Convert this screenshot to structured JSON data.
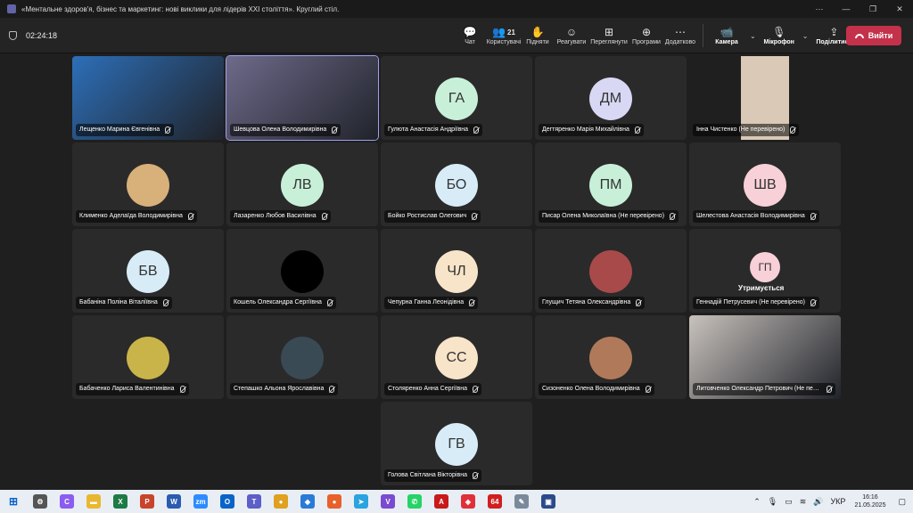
{
  "window": {
    "title": "«Ментальне здоров'я, бізнес та маркетинг: нові виклики для лідерів XXI століття». Круглий стіл.",
    "controls": [
      "⋯",
      "—",
      "❐",
      "✕"
    ]
  },
  "toolbar": {
    "timer": "02:24:18",
    "tools": [
      {
        "name": "chat",
        "icon": "💬",
        "label": "Чат"
      },
      {
        "name": "people",
        "icon": "👥",
        "count": "21",
        "label": "Користувачі"
      },
      {
        "name": "raise",
        "icon": "✋",
        "label": "Підняти"
      },
      {
        "name": "react",
        "icon": "☺",
        "label": "Реагувати"
      },
      {
        "name": "view",
        "icon": "⊞",
        "label": "Переглянути"
      },
      {
        "name": "apps",
        "icon": "⊕",
        "label": "Програми"
      },
      {
        "name": "more",
        "icon": "⋯",
        "label": "Додатково"
      }
    ],
    "camera": {
      "icon": "📹",
      "label": "Камера"
    },
    "mic": {
      "icon": "🎙",
      "label": "Мікрофон"
    },
    "share": {
      "icon": "⇪",
      "label": "Поділитися"
    },
    "leave": "Вийти"
  },
  "participants": [
    {
      "name": "Лещенко Марина Євгенівна",
      "kind": "video",
      "bg": "#2d6fb8"
    },
    {
      "name": "Шевцова Олена Володимирівна",
      "kind": "video",
      "bg": "#6e6a8a",
      "selected": true
    },
    {
      "name": "Гулюта Анастасія Андріївна",
      "initials": "ГА",
      "color": "#c8f0d8"
    },
    {
      "name": "Дегтяренко Марія Михайлівна",
      "initials": "ДМ",
      "color": "#d8d8f4"
    },
    {
      "name": "Інна Чистенко (Не перевірено)",
      "kind": "video",
      "bg": "#d9c9b6"
    },
    {
      "name": "Клименко Аделаїда Володимирівна",
      "kind": "photo",
      "bg": "#d8b07a"
    },
    {
      "name": "Лазаренко Любов Василівна",
      "initials": "ЛВ",
      "color": "#c8f0d8"
    },
    {
      "name": "Бойко Ростислав Олегович",
      "initials": "БО",
      "color": "#d8ecf8"
    },
    {
      "name": "Писар Олена Миколаївна (Не перевірено)",
      "initials": "ПМ",
      "color": "#c8f0d8"
    },
    {
      "name": "Шелестова Анастасія Володимирівна",
      "initials": "ШВ",
      "color": "#f8d0d8"
    },
    {
      "name": "Бабаніна Поліна Віталіївна",
      "initials": "БВ",
      "color": "#d8ecf8"
    },
    {
      "name": "Кошель Олександра Сергіївна",
      "kind": "photo",
      "bg": "#000000"
    },
    {
      "name": "Чепурна Ганна Леонідівна",
      "initials": "ЧЛ",
      "color": "#f8e4c8"
    },
    {
      "name": "Глущич Тетяна Олександрівна",
      "kind": "photo",
      "bg": "#a84a4a"
    },
    {
      "name": "Геннадій Петрусевич (Не перевірено)",
      "initials": "ГП",
      "color": "#f8d0d8",
      "small": true,
      "status": "Утримується"
    },
    {
      "name": "Бабаченко Лариса Валентинівна",
      "kind": "photo",
      "bg": "#c9b44a"
    },
    {
      "name": "Степашко Альона Ярославівна",
      "kind": "photo",
      "bg": "#3a4a55"
    },
    {
      "name": "Столяренко Анна Сергіївна",
      "initials": "СС",
      "color": "#f8e4c8"
    },
    {
      "name": "Сизоненко Олена Володимирівна",
      "kind": "photo",
      "bg": "#b07a5a"
    },
    {
      "name": "Литовченко Олександр Петрович (Не перевірено)",
      "kind": "video",
      "bg": "#c8c2bc"
    },
    {
      "name": "Голова Світлана Вікторівна",
      "initials": "ГВ",
      "color": "#d8ecf8"
    }
  ],
  "taskbar": {
    "apps": [
      {
        "name": "settings",
        "label": "⚙",
        "color": "#555"
      },
      {
        "name": "copilot",
        "label": "C",
        "color": "#8a5cf0"
      },
      {
        "name": "explorer",
        "label": "▬",
        "color": "#e8b830"
      },
      {
        "name": "excel",
        "label": "X",
        "color": "#1d7a45"
      },
      {
        "name": "powerpoint",
        "label": "P",
        "color": "#c8442a"
      },
      {
        "name": "word",
        "label": "W",
        "color": "#2a5cb0"
      },
      {
        "name": "zoom",
        "label": "zm",
        "color": "#2d8cff"
      },
      {
        "name": "outlook",
        "label": "O",
        "color": "#0a64c8"
      },
      {
        "name": "teams",
        "label": "T",
        "color": "#5b5fc7"
      },
      {
        "name": "chrome",
        "label": "●",
        "color": "#e0a020"
      },
      {
        "name": "blue-app",
        "label": "◆",
        "color": "#2a7ad8"
      },
      {
        "name": "firefox",
        "label": "●",
        "color": "#e8602a"
      },
      {
        "name": "telegram",
        "label": "➤",
        "color": "#2aa3e0"
      },
      {
        "name": "viber",
        "label": "V",
        "color": "#7a4ad0"
      },
      {
        "name": "whatsapp",
        "label": "✆",
        "color": "#25d366"
      },
      {
        "name": "pdf",
        "label": "A",
        "color": "#c81a1a"
      },
      {
        "name": "anydesk",
        "label": "◈",
        "color": "#e0303a"
      },
      {
        "name": "app-64",
        "label": "64",
        "color": "#d02020"
      },
      {
        "name": "pen-app",
        "label": "✎",
        "color": "#7a8a9a"
      },
      {
        "name": "save-app",
        "label": "▣",
        "color": "#2a4a8a"
      }
    ],
    "lang": "УКР",
    "time": "16:16",
    "date": "21.05.2025"
  }
}
